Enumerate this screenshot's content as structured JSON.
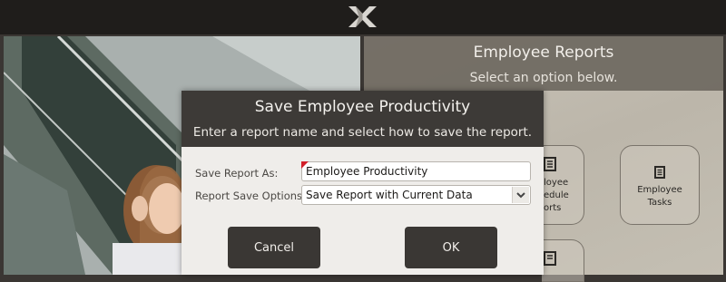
{
  "app": {
    "logo_icon": "oracle-x-logo"
  },
  "panel": {
    "title": "Employee Reports",
    "subtitle": "Select an option below.",
    "tiles": [
      {
        "label": "loyee\nedule\norts",
        "icon": "document-icon"
      },
      {
        "label": "Employee\nTasks",
        "icon": "document-icon"
      },
      {
        "label": "",
        "icon": "document-icon"
      }
    ]
  },
  "dialog": {
    "title": "Save Employee Productivity",
    "subtitle": "Enter a report name and select how to save the report.",
    "report_name_label": "Save Report As:",
    "report_name_value": "Employee Productivity",
    "save_options_label": "Report Save Options:",
    "save_options_selected": "Save Report with Current Data",
    "cancel_label": "Cancel",
    "ok_label": "OK"
  },
  "colors": {
    "topbar": "#1f1d1b",
    "dialog_header": "#3d3a37",
    "button": "#3a3734",
    "required_flag": "#d2202a"
  }
}
